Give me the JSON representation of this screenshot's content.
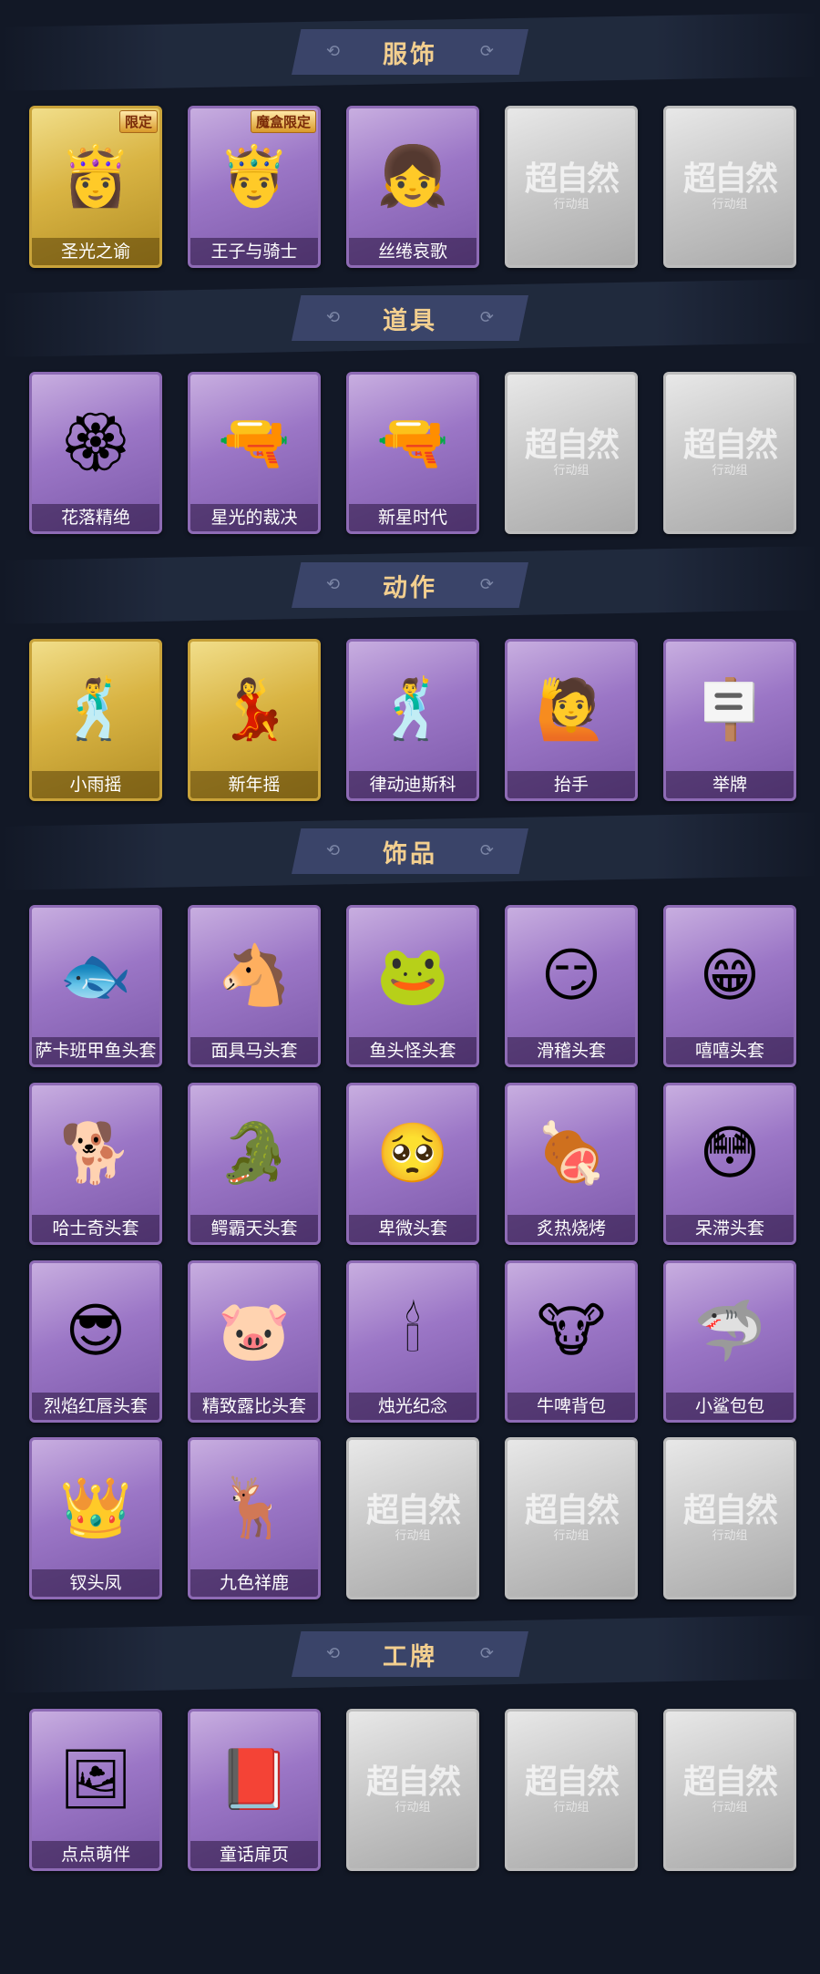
{
  "sections": [
    {
      "title": "服饰",
      "items": [
        {
          "label": "圣光之谕",
          "kind": "gold",
          "badge": "限定",
          "icon": "saint-girl-costume-icon",
          "glyph": "👸"
        },
        {
          "label": "王子与骑士",
          "kind": "purple",
          "badge": "魔盒限定",
          "icon": "prince-costume-icon",
          "glyph": "🤴"
        },
        {
          "label": "丝绻哀歌",
          "kind": "purple",
          "badge": "",
          "icon": "gothic-girl-costume-icon",
          "glyph": "👧"
        },
        {
          "label": "",
          "kind": "empty",
          "badge": "",
          "icon": "empty-slot-icon",
          "glyph": ""
        },
        {
          "label": "",
          "kind": "empty",
          "badge": "",
          "icon": "empty-slot-icon",
          "glyph": ""
        }
      ]
    },
    {
      "title": "道具",
      "items": [
        {
          "label": "花落精绝",
          "kind": "purple",
          "badge": "",
          "icon": "flower-necklace-icon",
          "glyph": "🏵"
        },
        {
          "label": "星光的裁决",
          "kind": "purple",
          "badge": "",
          "icon": "rifle-icon",
          "glyph": "🔫"
        },
        {
          "label": "新星时代",
          "kind": "purple",
          "badge": "",
          "icon": "revolver-icon",
          "glyph": "🔫"
        },
        {
          "label": "",
          "kind": "empty",
          "badge": "",
          "icon": "empty-slot-icon",
          "glyph": ""
        },
        {
          "label": "",
          "kind": "empty",
          "badge": "",
          "icon": "empty-slot-icon",
          "glyph": ""
        }
      ]
    },
    {
      "title": "动作",
      "items": [
        {
          "label": "小雨摇",
          "kind": "gold",
          "badge": "",
          "icon": "dance-pose-icon",
          "glyph": "🕺"
        },
        {
          "label": "新年摇",
          "kind": "gold",
          "badge": "",
          "icon": "dance-pose-icon",
          "glyph": "💃"
        },
        {
          "label": "律动迪斯科",
          "kind": "purple",
          "badge": "",
          "icon": "disco-pose-icon",
          "glyph": "🕺"
        },
        {
          "label": "抬手",
          "kind": "purple",
          "badge": "",
          "icon": "raise-hand-pose-icon",
          "glyph": "🙋"
        },
        {
          "label": "举牌",
          "kind": "purple",
          "badge": "",
          "icon": "hold-sign-pose-icon",
          "glyph": "🪧"
        }
      ]
    },
    {
      "title": "饰品",
      "items": [
        {
          "label": "萨卡班甲鱼头套",
          "kind": "purple",
          "badge": "",
          "icon": "fish-head-icon",
          "glyph": "🐟"
        },
        {
          "label": "面具马头套",
          "kind": "purple",
          "badge": "",
          "icon": "horse-head-icon",
          "glyph": "🐴"
        },
        {
          "label": "鱼头怪头套",
          "kind": "purple",
          "badge": "",
          "icon": "fish-monster-head-icon",
          "glyph": "🐸"
        },
        {
          "label": "滑稽头套",
          "kind": "purple",
          "badge": "",
          "icon": "funny-face-icon",
          "glyph": "😏"
        },
        {
          "label": "嘻嘻头套",
          "kind": "purple",
          "badge": "",
          "icon": "grin-face-icon",
          "glyph": "😁"
        },
        {
          "label": "哈士奇头套",
          "kind": "purple",
          "badge": "",
          "icon": "husky-head-icon",
          "glyph": "🐕"
        },
        {
          "label": "鳄霸天头套",
          "kind": "purple",
          "badge": "",
          "icon": "crocodile-head-icon",
          "glyph": "🐊"
        },
        {
          "label": "卑微头套",
          "kind": "purple",
          "badge": "",
          "icon": "humble-face-icon",
          "glyph": "🥺"
        },
        {
          "label": "炙热烧烤",
          "kind": "purple",
          "badge": "",
          "icon": "bbq-meat-icon",
          "glyph": "🍖"
        },
        {
          "label": "呆滞头套",
          "kind": "purple",
          "badge": "",
          "icon": "dazed-face-icon",
          "glyph": "😳"
        },
        {
          "label": "烈焰红唇头套",
          "kind": "purple",
          "badge": "",
          "icon": "yellow-mascot-head-icon",
          "glyph": "😎"
        },
        {
          "label": "精致露比头套",
          "kind": "purple",
          "badge": "",
          "icon": "pink-beaver-head-icon",
          "glyph": "🐷"
        },
        {
          "label": "烛光纪念",
          "kind": "purple",
          "badge": "",
          "icon": "candle-icon",
          "glyph": "🕯"
        },
        {
          "label": "牛啤背包",
          "kind": "purple",
          "badge": "",
          "icon": "cow-beer-backpack-icon",
          "glyph": "🐮"
        },
        {
          "label": "小鲨包包",
          "kind": "purple",
          "badge": "",
          "icon": "shark-bag-icon",
          "glyph": "🦈"
        },
        {
          "label": "钗头凤",
          "kind": "purple",
          "badge": "",
          "icon": "phoenix-crown-icon",
          "glyph": "👑"
        },
        {
          "label": "九色祥鹿",
          "kind": "purple",
          "badge": "",
          "icon": "deer-pendant-icon",
          "glyph": "🦌"
        },
        {
          "label": "",
          "kind": "empty",
          "badge": "",
          "icon": "empty-slot-icon",
          "glyph": ""
        },
        {
          "label": "",
          "kind": "empty",
          "badge": "",
          "icon": "empty-slot-icon",
          "glyph": ""
        },
        {
          "label": "",
          "kind": "empty",
          "badge": "",
          "icon": "empty-slot-icon",
          "glyph": ""
        }
      ]
    },
    {
      "title": "工牌",
      "items": [
        {
          "label": "点点萌伴",
          "kind": "purple",
          "badge": "",
          "icon": "landscape-badge-icon",
          "glyph": "🖼"
        },
        {
          "label": "童话扉页",
          "kind": "purple",
          "badge": "",
          "icon": "storybook-page-icon",
          "glyph": "📕"
        },
        {
          "label": "",
          "kind": "empty",
          "badge": "",
          "icon": "empty-slot-icon",
          "glyph": ""
        },
        {
          "label": "",
          "kind": "empty",
          "badge": "",
          "icon": "empty-slot-icon",
          "glyph": ""
        },
        {
          "label": "",
          "kind": "empty",
          "badge": "",
          "icon": "empty-slot-icon",
          "glyph": ""
        }
      ]
    }
  ],
  "empty_slot": {
    "mark": "超自然",
    "sub": "行动组"
  },
  "colors": {
    "background": "#121826",
    "title_text": "#f3cf8f",
    "title_banner": "#3a4469",
    "purple_card": "#9b76c6",
    "gold_card": "#d9b443",
    "empty_card": "#c6c6c6"
  }
}
